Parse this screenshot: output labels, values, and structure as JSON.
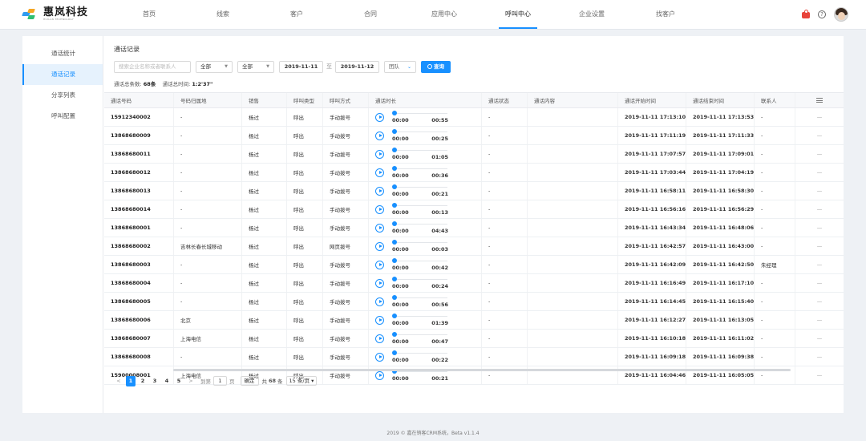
{
  "brand": {
    "name": "惠岚科技",
    "subtitle": "HUILAN TECHNOLOGY"
  },
  "nav": [
    {
      "label": "首页",
      "active": false
    },
    {
      "label": "线索",
      "active": false
    },
    {
      "label": "客户",
      "active": false
    },
    {
      "label": "合同",
      "active": false
    },
    {
      "label": "应用中心",
      "active": false
    },
    {
      "label": "呼叫中心",
      "active": true
    },
    {
      "label": "企业设置",
      "active": false
    },
    {
      "label": "找客户",
      "active": false
    }
  ],
  "colors": {
    "accent": "#1890ff",
    "notif": "#e8433a"
  },
  "sidebar": {
    "items": [
      {
        "label": "通话统计",
        "active": false
      },
      {
        "label": "通话记录",
        "active": true
      },
      {
        "label": "分享列表",
        "active": false
      },
      {
        "label": "呼叫配置",
        "active": false
      }
    ]
  },
  "page": {
    "title": "通话记录"
  },
  "filters": {
    "search_placeholder": "搜索企业名称或者联系人",
    "select1": "全部",
    "select2": "全部",
    "date_from": "2019-11-11",
    "date_sep": "至",
    "date_to": "2019-11-12",
    "team": "团队",
    "query_label": "查询"
  },
  "summary": {
    "count_label": "通话总条数:",
    "count_value": "68条",
    "time_label": "通话总时间:",
    "time_value": "1:2'37\""
  },
  "table": {
    "headers": [
      "通话号码",
      "号码归属地",
      "销售",
      "呼叫类型",
      "呼叫方式",
      "通话时长",
      "通话状态",
      "通话内容",
      "通话开始时间",
      "通话结束时间",
      "联系人",
      ""
    ],
    "rows": [
      {
        "number": "15912340002",
        "location": "-",
        "sales": "杨过",
        "type": "呼出",
        "method": "手动拨号",
        "t0": "00:00",
        "dur": "00:55",
        "status": "-",
        "content": "",
        "start": "2019-11-11 17:13:10",
        "end": "2019-11-11 17:13:53",
        "contact": "-",
        "more": "—"
      },
      {
        "number": "13868680009",
        "location": "-",
        "sales": "杨过",
        "type": "呼出",
        "method": "手动拨号",
        "t0": "00:00",
        "dur": "00:25",
        "status": "-",
        "content": "",
        "start": "2019-11-11 17:11:19",
        "end": "2019-11-11 17:11:33",
        "contact": "-",
        "more": "—"
      },
      {
        "number": "13868680011",
        "location": "-",
        "sales": "杨过",
        "type": "呼出",
        "method": "手动拨号",
        "t0": "00:00",
        "dur": "01:05",
        "status": "-",
        "content": "",
        "start": "2019-11-11 17:07:57",
        "end": "2019-11-11 17:09:01",
        "contact": "-",
        "more": "—"
      },
      {
        "number": "13868680012",
        "location": "-",
        "sales": "杨过",
        "type": "呼出",
        "method": "手动拨号",
        "t0": "00:00",
        "dur": "00:36",
        "status": "-",
        "content": "",
        "start": "2019-11-11 17:03:44",
        "end": "2019-11-11 17:04:19",
        "contact": "-",
        "more": "—"
      },
      {
        "number": "13868680013",
        "location": "-",
        "sales": "杨过",
        "type": "呼出",
        "method": "手动拨号",
        "t0": "00:00",
        "dur": "00:21",
        "status": "-",
        "content": "",
        "start": "2019-11-11 16:58:11",
        "end": "2019-11-11 16:58:30",
        "contact": "-",
        "more": "—"
      },
      {
        "number": "13868680014",
        "location": "-",
        "sales": "杨过",
        "type": "呼出",
        "method": "手动拨号",
        "t0": "00:00",
        "dur": "00:13",
        "status": "-",
        "content": "",
        "start": "2019-11-11 16:56:16",
        "end": "2019-11-11 16:56:29",
        "contact": "-",
        "more": "—"
      },
      {
        "number": "13868680001",
        "location": "-",
        "sales": "杨过",
        "type": "呼出",
        "method": "手动拨号",
        "t0": "00:00",
        "dur": "04:43",
        "status": "-",
        "content": "",
        "start": "2019-11-11 16:43:34",
        "end": "2019-11-11 16:48:06",
        "contact": "-",
        "more": "—"
      },
      {
        "number": "13868680002",
        "location": "吉林长春长城移动",
        "sales": "杨过",
        "type": "呼出",
        "method": "网页拨号",
        "t0": "00:00",
        "dur": "00:03",
        "status": "-",
        "content": "",
        "start": "2019-11-11 16:42:57",
        "end": "2019-11-11 16:43:00",
        "contact": "-",
        "more": "—"
      },
      {
        "number": "13868680003",
        "location": "-",
        "sales": "杨过",
        "type": "呼出",
        "method": "手动拨号",
        "t0": "00:00",
        "dur": "00:42",
        "status": "-",
        "content": "",
        "start": "2019-11-11 16:42:09",
        "end": "2019-11-11 16:42:50",
        "contact": "朱经理",
        "more": "—"
      },
      {
        "number": "13868680004",
        "location": "-",
        "sales": "杨过",
        "type": "呼出",
        "method": "手动拨号",
        "t0": "00:00",
        "dur": "00:24",
        "status": "-",
        "content": "",
        "start": "2019-11-11 16:16:49",
        "end": "2019-11-11 16:17:10",
        "contact": "-",
        "more": "—"
      },
      {
        "number": "13868680005",
        "location": "-",
        "sales": "杨过",
        "type": "呼出",
        "method": "手动拨号",
        "t0": "00:00",
        "dur": "00:56",
        "status": "-",
        "content": "",
        "start": "2019-11-11 16:14:45",
        "end": "2019-11-11 16:15:40",
        "contact": "-",
        "more": "—"
      },
      {
        "number": "13868680006",
        "location": "北京",
        "sales": "杨过",
        "type": "呼出",
        "method": "手动拨号",
        "t0": "00:00",
        "dur": "01:39",
        "status": "-",
        "content": "",
        "start": "2019-11-11 16:12:27",
        "end": "2019-11-11 16:13:05",
        "contact": "-",
        "more": "—"
      },
      {
        "number": "13868680007",
        "location": "上海电信",
        "sales": "杨过",
        "type": "呼出",
        "method": "手动拨号",
        "t0": "00:00",
        "dur": "00:47",
        "status": "-",
        "content": "",
        "start": "2019-11-11 16:10:18",
        "end": "2019-11-11 16:11:02",
        "contact": "-",
        "more": "—"
      },
      {
        "number": "13868680008",
        "location": "-",
        "sales": "杨过",
        "type": "呼出",
        "method": "手动拨号",
        "t0": "00:00",
        "dur": "00:22",
        "status": "-",
        "content": "",
        "start": "2019-11-11 16:09:18",
        "end": "2019-11-11 16:09:38",
        "contact": "-",
        "more": "—"
      },
      {
        "number": "15900008001",
        "location": "上海电信",
        "sales": "杨过",
        "type": "呼出",
        "method": "手动拨号",
        "t0": "00:00",
        "dur": "00:21",
        "status": "-",
        "content": "",
        "start": "2019-11-11 16:04:46",
        "end": "2019-11-11 16:05:05",
        "contact": "-",
        "more": "—"
      }
    ]
  },
  "pagination": {
    "prev": "<",
    "pages": [
      "1",
      "2",
      "3",
      "4",
      "5"
    ],
    "current": "1",
    "next": ">",
    "goto_label": "到第",
    "goto_value": "1",
    "page_unit": "页",
    "confirm_label": "确定",
    "total_label": "共",
    "total_value": "68",
    "total_unit": "条",
    "page_size": "15 条/页"
  },
  "footer": {
    "text": "2019 © 嘉在销客CRM系统，Beta v1.1.4"
  }
}
